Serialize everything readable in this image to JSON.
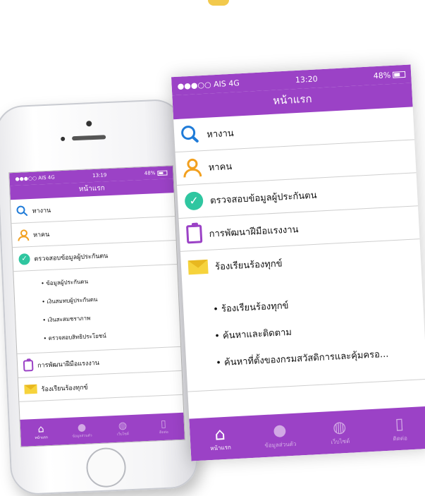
{
  "phone": {
    "status": {
      "carrier": "●●●○○ AIS 4G",
      "time": "13:19",
      "battery": "48%"
    },
    "title": "หน้าแรก",
    "menu": [
      {
        "label": "หางาน",
        "icon": "search-icon"
      },
      {
        "label": "หาคน",
        "icon": "user-icon"
      },
      {
        "label": "ตรวจสอบข้อมูลผู้ประกันตน",
        "icon": "check-circle-icon"
      }
    ],
    "submenu": [
      "• ข้อมูลผู้ประกันตน",
      "• เงินสมทบผู้ประกันตน",
      "• เงินสะสมชราภาพ",
      "• ตรวจสอบสิทธิประโยชน์"
    ],
    "menu2": [
      {
        "label": "การพัฒนาฝีมือแรงงาน",
        "icon": "clipboard-icon"
      },
      {
        "label": "ร้องเรียนร้องทุกข์",
        "icon": "mail-icon"
      }
    ],
    "tabs": [
      "หน้าแรก",
      "ข้อมูลส่วนตัว",
      "เว็บไซต์",
      "ติดต่อ"
    ]
  },
  "panel": {
    "status": {
      "carrier": "●●●○○ AIS 4G",
      "time": "13:20",
      "battery": "48%"
    },
    "title": "หน้าแรก",
    "menu": [
      {
        "label": "หางาน",
        "icon": "search-icon"
      },
      {
        "label": "หาคน",
        "icon": "user-icon"
      },
      {
        "label": "ตรวจสอบข้อมูลผู้ประกันตน",
        "icon": "check-circle-icon"
      },
      {
        "label": "การพัฒนาฝีมือแรงงาน",
        "icon": "clipboard-icon"
      },
      {
        "label": "ร้องเรียนร้องทุกข์",
        "icon": "mail-icon"
      }
    ],
    "submenu": [
      "• ร้องเรียนร้องทุกข์",
      "• ค้นหาและติดตาม",
      "• ค้นหาที่ตั้งของกรมสวัสดิการและคุ้มครอ..."
    ],
    "tabs": [
      "หน้าแรก",
      "ข้อมูลส่วนตัว",
      "เว็บไซต์",
      "ติดต่อ"
    ]
  },
  "colors": {
    "brand": "#9b42c6",
    "search": "#1f7bd8",
    "user": "#f2a01f",
    "check": "#2fc6a0",
    "mail": "#f6d33c"
  }
}
